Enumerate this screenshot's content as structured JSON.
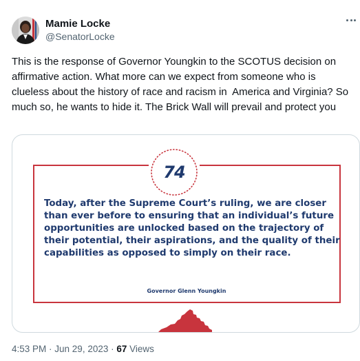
{
  "author": {
    "display_name": "Mamie Locke",
    "handle": "@SenatorLocke"
  },
  "tweet": {
    "text": "This is the response of Governor Youngkin to the SCOTUS decision on affirmative action. What more can we expect from someone who is clueless about the history of race and racism in  America and Virginia? So much so, he wants to hide it. The Brick Wall will prevail and protect you"
  },
  "media_card": {
    "number": "74",
    "quote": "Today, after the Supreme Court’s ruling, we are closer than ever before to ensuring that an individual’s future opportunities are unlocked based on the trajectory of their potential, their aspirations, and the quality of their capabilities as opposed to simply on their race.",
    "attribution": "Governor Glenn Youngkin",
    "colors": {
      "frame": "#c8343d",
      "text": "#1f3a6e",
      "state_shape": "#c8343d"
    },
    "state_shape_icon": "virginia-state-icon"
  },
  "meta": {
    "time": "4:53 PM",
    "separator": " · ",
    "date": "Jun 29, 2023",
    "views_count": "67",
    "views_label": "Views"
  },
  "icons": {
    "more": "more-options-icon",
    "avatar": "avatar-photo"
  }
}
